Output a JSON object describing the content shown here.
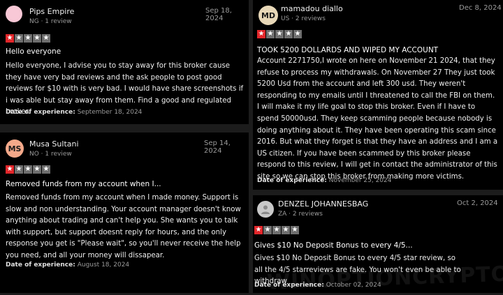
{
  "reviews": [
    {
      "avatar_initials": "",
      "avatar_color": "#f8c8d6",
      "name": "Pips Empire",
      "meta": "NG · 1 review",
      "date": "Sep 18, 2024",
      "rating": 1,
      "title": "Hello everyone",
      "body": "Hello everyone, I advise you to stay away for this broker cause they have very bad reviews and the ask people to post good reviews for $10 with is very bad. I would have share screenshots if i was able but stay away from them. Find a good and regulated broker.",
      "exp_label": "Date of experience:",
      "exp_date": "September 18, 2024"
    },
    {
      "avatar_initials": "MS",
      "avatar_color": "#f4a98a",
      "name": "Musa Sultani",
      "meta": "NO · 1 review",
      "date": "Sep 14, 2024",
      "rating": 1,
      "title": "Removed funds from my account when I...",
      "body": "Removed funds from my account when I made money. Support is slow and non understanding. Your account manager doesn't know anything about trading and can't help you. She wants you to talk with support, but support doesnt reply for hours, and the only response you get is \"Please wait\", so you'll never receive the help you need, and all your money will dissapear.",
      "exp_label": "Date of experience:",
      "exp_date": "August 18, 2024"
    },
    {
      "avatar_initials": "MD",
      "avatar_color": "#e8d8b8",
      "name": "mamadou diallo",
      "meta": "US · 2 reviews",
      "date": "Dec 8, 2024",
      "rating": 1,
      "title": "TOOK 5200 DOLLARDS AND WIPED MY ACCOUNT",
      "body": "Account 2271750,I wrote on here on November 21 2024, that they refuse to process my withdrawals. On November 27 They just took 5200 Usd from the account and left 300 usd. They weren't responding to my emails until I threatened to call the FBI on them. I will make it my life goal to stop this broker. Even if I have to spend 50000usd. They keep scamming people because nobody is doing anything about it. They have been operating this scam since 2016. But what they forget is that they have an address and I am a US citizen. If you have been scammed by this broker please respond to this review, I will get in contact the administrator of this site so we can stop this broker from making more victims.",
      "exp_label": "Date of experience:",
      "exp_date": "November 25, 2024"
    },
    {
      "avatar_initials": "",
      "avatar_color": "#c9c9c9",
      "name": "DENZEL JOHANNESBAG",
      "meta": "ZA · 2 reviews",
      "date": "Oct 2, 2024",
      "rating": 1,
      "title": "Gives $10 No Deposit Bonus to every 4/5...",
      "body": "Gives $10 No Deposit Bonus to every 4/5 star review, so all the 4/5 starreviews are fake. You won't even be able to withdraw",
      "exp_label": "Date of experience:",
      "exp_date": "October 02, 2024"
    }
  ],
  "watermark": "WINOPTIONCRYPTO.COM"
}
